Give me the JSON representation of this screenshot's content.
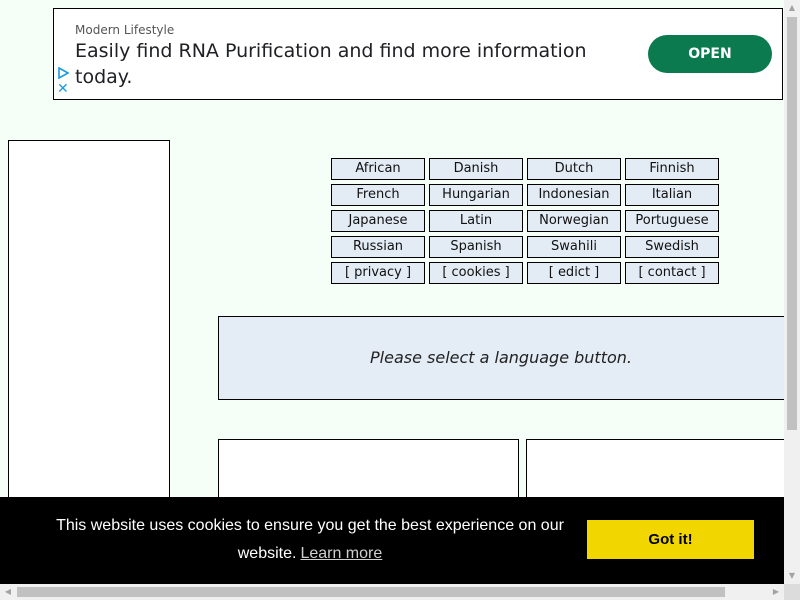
{
  "ad": {
    "advertiser": "Modern Lifestyle",
    "headline": "Easily find RNA Purification and find more information today.",
    "cta_label": "OPEN",
    "cta_color": "#0b7a4f",
    "choices_icon": "adchoices-triangle-icon",
    "close_icon": "close-x-icon",
    "close_glyph": "✕"
  },
  "languages": [
    "African",
    "Danish",
    "Dutch",
    "Finnish",
    "French",
    "Hungarian",
    "Indonesian",
    "Italian",
    "Japanese",
    "Latin",
    "Norwegian",
    "Portuguese",
    "Russian",
    "Spanish",
    "Swahili",
    "Swedish"
  ],
  "footer_links": [
    "[ privacy ]",
    "[ cookies ]",
    "[ edict ]",
    "[ contact ]"
  ],
  "message": "Please select a language button.",
  "cookie_consent": {
    "text": "This website uses cookies to ensure you get the best experience on our website.",
    "learn_more": "Learn more",
    "accept_label": "Got it!",
    "button_color": "#f1d600"
  },
  "scrollbars": {
    "up_glyph": "▲",
    "down_glyph": "▼",
    "left_glyph": "◀",
    "right_glyph": "▶"
  }
}
